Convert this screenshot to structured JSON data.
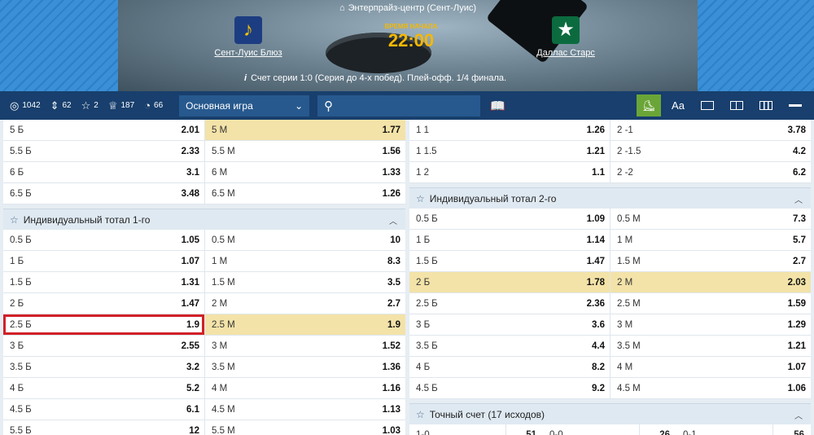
{
  "header": {
    "venue": "Энтерпрайз-центр (Сент-Луис)",
    "team1": "Сент-Луис Блюз",
    "team2": "Даллас Старс",
    "start_label": "ВРЕМЯ НАЧАЛА",
    "start_time": "22:00",
    "series_info": "Счет серии 1:0 (Серия до 4-х побед). Плей-офф. 1/4 финала."
  },
  "toolbar": {
    "stats": [
      {
        "icon": "target-icon",
        "value": "1042"
      },
      {
        "icon": "sort-icon",
        "value": "62"
      },
      {
        "icon": "star-icon",
        "value": "2"
      },
      {
        "icon": "trophy-icon",
        "value": "187"
      },
      {
        "icon": "timer-icon",
        "value": "66"
      }
    ],
    "mode": "Основная игра",
    "font_button": "Aa"
  },
  "left": {
    "top_rows": [
      {
        "l1": "5 Б",
        "o1": "2.01",
        "l2": "5 М",
        "o2": "1.77",
        "sel": 2
      },
      {
        "l1": "5.5 Б",
        "o1": "2.33",
        "l2": "5.5 М",
        "o2": "1.56"
      },
      {
        "l1": "6 Б",
        "o1": "3.1",
        "l2": "6 М",
        "o2": "1.33"
      },
      {
        "l1": "6.5 Б",
        "o1": "3.48",
        "l2": "6.5 М",
        "o2": "1.26"
      }
    ],
    "section_title": "Индивидуальный тотал 1-го",
    "rows": [
      {
        "l1": "0.5 Б",
        "o1": "1.05",
        "l2": "0.5 М",
        "o2": "10"
      },
      {
        "l1": "1 Б",
        "o1": "1.07",
        "l2": "1 М",
        "o2": "8.3"
      },
      {
        "l1": "1.5 Б",
        "o1": "1.31",
        "l2": "1.5 М",
        "o2": "3.5"
      },
      {
        "l1": "2 Б",
        "o1": "1.47",
        "l2": "2 М",
        "o2": "2.7"
      },
      {
        "l1": "2.5 Б",
        "o1": "1.9",
        "l2": "2.5 М",
        "o2": "1.9",
        "sel": 2,
        "hl": 1
      },
      {
        "l1": "3 Б",
        "o1": "2.55",
        "l2": "3 М",
        "o2": "1.52"
      },
      {
        "l1": "3.5 Б",
        "o1": "3.2",
        "l2": "3.5 М",
        "o2": "1.36"
      },
      {
        "l1": "4 Б",
        "o1": "5.2",
        "l2": "4 М",
        "o2": "1.16"
      },
      {
        "l1": "4.5 Б",
        "o1": "6.1",
        "l2": "4.5 М",
        "o2": "1.13"
      },
      {
        "l1": "5.5 Б",
        "o1": "12",
        "l2": "5.5 М",
        "o2": "1.03"
      }
    ]
  },
  "right": {
    "top_rows": [
      {
        "l1": "1 1",
        "o1": "1.26",
        "l2": "2 -1",
        "o2": "3.78"
      },
      {
        "l1": "1 1.5",
        "o1": "1.21",
        "l2": "2 -1.5",
        "o2": "4.2"
      },
      {
        "l1": "1 2",
        "o1": "1.1",
        "l2": "2 -2",
        "o2": "6.2"
      }
    ],
    "section_title": "Индивидуальный тотал 2-го",
    "rows": [
      {
        "l1": "0.5 Б",
        "o1": "1.09",
        "l2": "0.5 М",
        "o2": "7.3"
      },
      {
        "l1": "1 Б",
        "o1": "1.14",
        "l2": "1 М",
        "o2": "5.7"
      },
      {
        "l1": "1.5 Б",
        "o1": "1.47",
        "l2": "1.5 М",
        "o2": "2.7"
      },
      {
        "l1": "2 Б",
        "o1": "1.78",
        "l2": "2 М",
        "o2": "2.03",
        "sel": 3
      },
      {
        "l1": "2.5 Б",
        "o1": "2.36",
        "l2": "2.5 М",
        "o2": "1.59"
      },
      {
        "l1": "3 Б",
        "o1": "3.6",
        "l2": "3 М",
        "o2": "1.29"
      },
      {
        "l1": "3.5 Б",
        "o1": "4.4",
        "l2": "3.5 М",
        "o2": "1.21"
      },
      {
        "l1": "4 Б",
        "o1": "8.2",
        "l2": "4 М",
        "o2": "1.07"
      },
      {
        "l1": "4.5 Б",
        "o1": "9.2",
        "l2": "4.5 М",
        "o2": "1.06"
      }
    ],
    "exact_title": "Точный счет (17 исходов)",
    "exact_row": [
      {
        "label": "1-0",
        "odd": "51"
      },
      {
        "label": "0-0",
        "odd": "26"
      },
      {
        "label": "0-1",
        "odd": "56"
      }
    ]
  },
  "colors": {
    "toolbar": "#183f6d",
    "selected": "#f3e3a8",
    "highlight": "#d22027",
    "active_button": "#6aa537"
  }
}
